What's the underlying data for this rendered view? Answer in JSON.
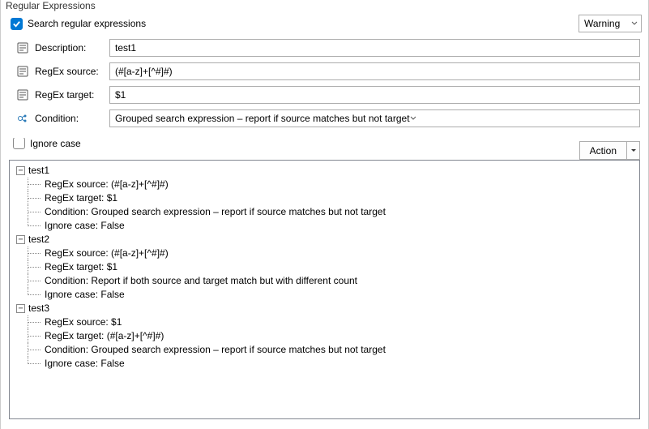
{
  "panel": {
    "title": "Regular Expressions",
    "search_checkbox_checked": true,
    "search_label": "Search regular expressions",
    "severity_selected": "Warning"
  },
  "form": {
    "description_label": "Description:",
    "description_value": "test1",
    "regex_source_label": "RegEx source:",
    "regex_source_value": "(#[a-z]+[^#]#)",
    "regex_target_label": "RegEx target:",
    "regex_target_value": "$1",
    "condition_label": "Condition:",
    "condition_value": "Grouped search expression – report if source matches but not target",
    "ignore_case_label": "Ignore case",
    "ignore_case_checked": false
  },
  "actions": {
    "action_label": "Action"
  },
  "tree": [
    {
      "name": "test1",
      "details": {
        "regex_source": "RegEx source: (#[a-z]+[^#]#)",
        "regex_target": "RegEx target: $1",
        "condition": "Condition: Grouped search expression – report if source matches but not target",
        "ignore_case": "Ignore case: False"
      }
    },
    {
      "name": "test2",
      "details": {
        "regex_source": "RegEx source: (#[a-z]+[^#]#)",
        "regex_target": "RegEx target: $1",
        "condition": "Condition: Report if both source and target match but with different count",
        "ignore_case": "Ignore case: False"
      }
    },
    {
      "name": "test3",
      "details": {
        "regex_source": "RegEx source: $1",
        "regex_target": "RegEx target: (#[a-z]+[^#]#)",
        "condition": "Condition: Grouped search expression – report if source matches but not target",
        "ignore_case": "Ignore case: False"
      }
    }
  ]
}
